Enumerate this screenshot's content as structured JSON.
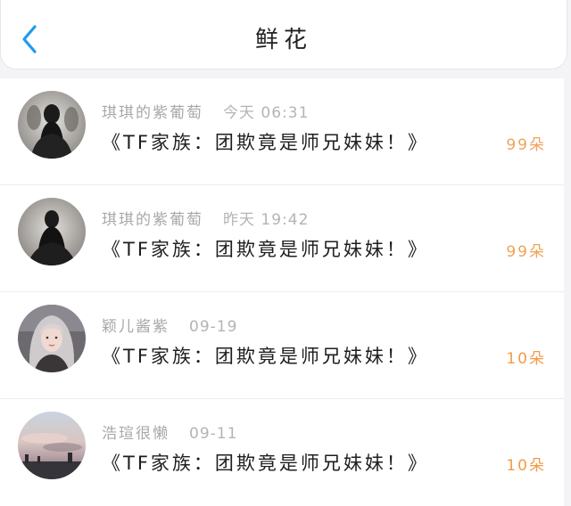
{
  "header": {
    "title": "鲜花"
  },
  "colors": {
    "back_arrow": "#1e9bf0",
    "count_orange": "#f0a35a",
    "count_blue": "#f29b48"
  },
  "items": [
    {
      "name": "琪琪的紫葡萄",
      "time": "今天 06:31",
      "title": "《TF家族：团欺竟是师兄妹妹！》",
      "count": "99朵",
      "count_color": "#f0a35a",
      "avatar_icon": "dark-figure-avatar"
    },
    {
      "name": "琪琪的紫葡萄",
      "time": "昨天 19:42",
      "title": "《TF家族：团欺竟是师兄妹妹！》",
      "count": "99朵",
      "count_color": "#f0a35a",
      "avatar_icon": "dark-figure-avatar"
    },
    {
      "name": "颖儿酱紫",
      "time": "09-19",
      "title": "《TF家族：团欺竟是师兄妹妹！》",
      "count": "10朵",
      "count_color": "#f29b48",
      "avatar_icon": "girl-portrait-avatar"
    },
    {
      "name": "浩瑄很懒",
      "time": "09-11",
      "title": "《TF家族：团欺竟是师兄妹妹！》",
      "count": "10朵",
      "count_color": "#f29b48",
      "avatar_icon": "sky-landscape-avatar"
    }
  ]
}
